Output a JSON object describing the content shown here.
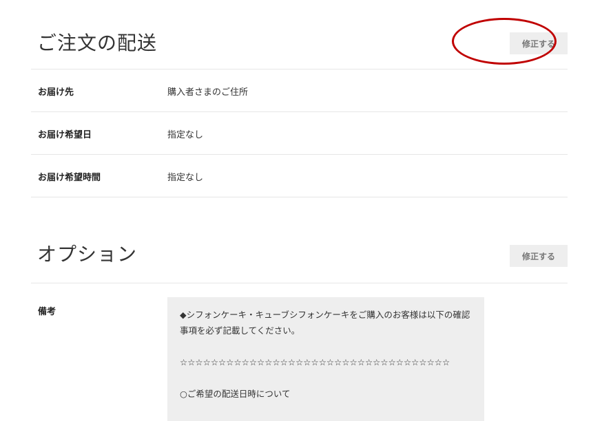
{
  "delivery": {
    "title": "ご注文の配送",
    "edit_label": "修正する",
    "rows": [
      {
        "label": "お届け先",
        "value": "購入者さまのご住所"
      },
      {
        "label": "お届け希望日",
        "value": "指定なし"
      },
      {
        "label": "お届け希望時間",
        "value": "指定なし"
      }
    ]
  },
  "options": {
    "title": "オプション",
    "edit_label": "修正する",
    "notes_label": "備考",
    "notes_lines": [
      "◆シフォンケーキ・キューブシフォンケーキをご購入のお客様は以下の確認事項を必ず記載してください。",
      "☆☆☆☆☆☆☆☆☆☆☆☆☆☆☆☆☆☆☆☆☆☆☆☆☆☆☆☆☆☆☆☆☆☆☆",
      "○ご希望の配送日時について"
    ]
  },
  "annotation": {
    "highlight_color": "#c00000"
  }
}
